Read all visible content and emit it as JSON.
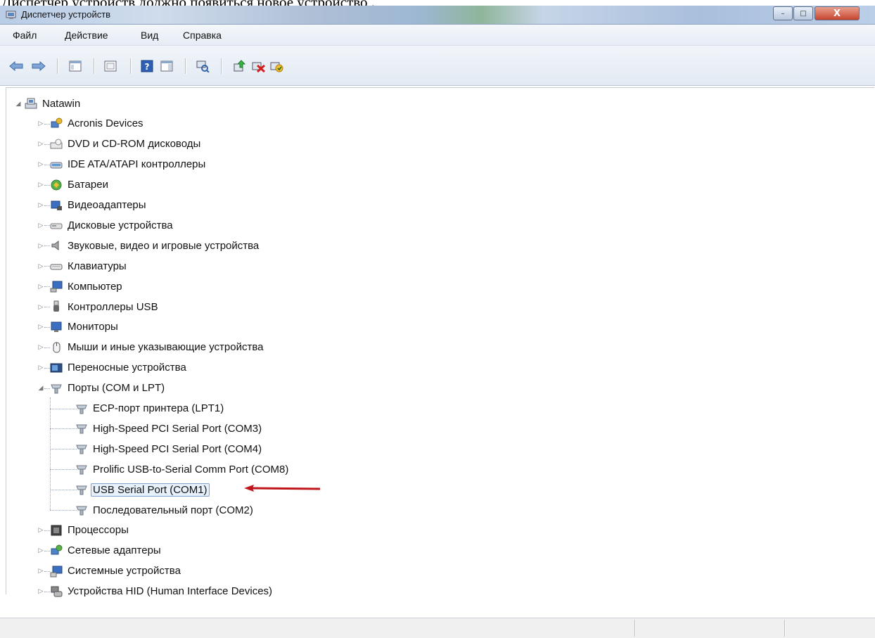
{
  "caption": "Диспетчер устройств должно появиться новое устройство .",
  "window": {
    "title": "Диспетчер устройств",
    "buttons": {
      "minimize": "–",
      "maximize": "□",
      "close": "X"
    }
  },
  "menu": [
    "Файл",
    "Действие",
    "Вид",
    "Справка"
  ],
  "toolbar": {
    "icons": [
      "back-arrow-icon",
      "forward-arrow-icon",
      "properties-view-icon",
      "window-icon",
      "help-icon",
      "action-pane-icon",
      "scan-hardware-icon",
      "update-driver-icon",
      "disable-device-icon",
      "uninstall-device-icon"
    ]
  },
  "tree": {
    "root": "Natawin",
    "categories": [
      {
        "label": "Acronis Devices",
        "icon": "network-device-icon"
      },
      {
        "label": "DVD и CD-ROM дисководы",
        "icon": "cd-drive-icon"
      },
      {
        "label": "IDE ATA/ATAPI контроллеры",
        "icon": "ide-controller-icon"
      },
      {
        "label": "Батареи",
        "icon": "battery-icon"
      },
      {
        "label": "Видеоадаптеры",
        "icon": "display-adapter-icon"
      },
      {
        "label": "Дисковые устройства",
        "icon": "disk-drive-icon"
      },
      {
        "label": "Звуковые, видео и игровые устройства",
        "icon": "speaker-icon"
      },
      {
        "label": "Клавиатуры",
        "icon": "keyboard-icon"
      },
      {
        "label": "Компьютер",
        "icon": "computer-icon"
      },
      {
        "label": "Контроллеры USB",
        "icon": "usb-plug-icon"
      },
      {
        "label": "Мониторы",
        "icon": "monitor-icon"
      },
      {
        "label": "Мыши и иные указывающие устройства",
        "icon": "mouse-icon"
      },
      {
        "label": "Переносные устройства",
        "icon": "portable-device-icon"
      },
      {
        "label": "Порты (COM и LPT)",
        "icon": "port-icon",
        "expanded": true,
        "children": [
          {
            "label": "ECP-порт принтера (LPT1)"
          },
          {
            "label": "High-Speed PCI Serial Port (COM3)"
          },
          {
            "label": "High-Speed PCI Serial Port (COM4)"
          },
          {
            "label": "Prolific USB-to-Serial Comm Port (COM8)"
          },
          {
            "label": "USB Serial Port (COM1)",
            "selected": true
          },
          {
            "label": "Последовательный порт (COM2)"
          }
        ]
      },
      {
        "label": "Процессоры",
        "icon": "processor-icon"
      },
      {
        "label": "Сетевые адаптеры",
        "icon": "network-adapter-icon"
      },
      {
        "label": "Системные устройства",
        "icon": "system-device-icon"
      },
      {
        "label": "Устройства HID (Human Interface Devices)",
        "icon": "hid-device-icon"
      }
    ]
  },
  "colors": {
    "arrow": "#c0151a",
    "selection_border": "#7da2ce",
    "selection_fill": "#e7f1fb"
  }
}
